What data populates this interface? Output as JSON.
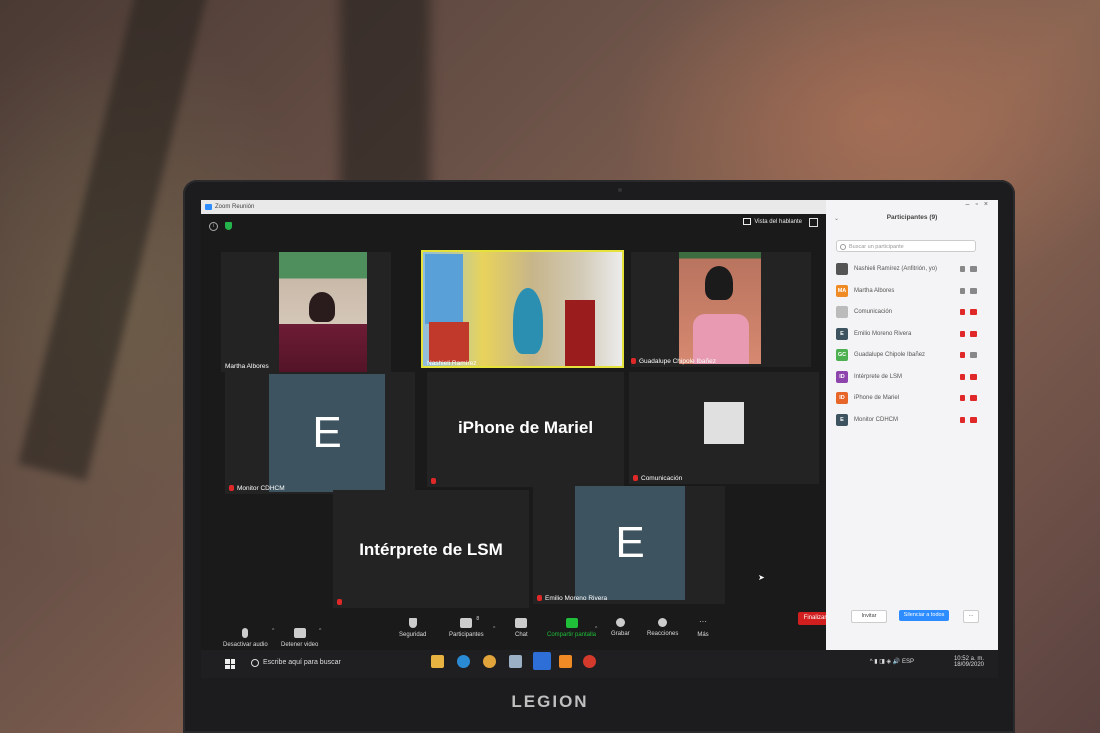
{
  "window": {
    "title": "Zoom Reunión",
    "speaker_view": "Vista del hablante"
  },
  "tiles": [
    {
      "name": "Martha Albores"
    },
    {
      "name": "Nashieli Ramírez"
    },
    {
      "name": "Guadalupe Chipole Ibañez"
    },
    {
      "name": "Monitor CDHCM",
      "initial": "E"
    },
    {
      "display": "iPhone de Mariel"
    },
    {
      "name": "Comunicación"
    },
    {
      "display": "Intérprete de LSM"
    },
    {
      "name": "Emilio Moreno Rivera",
      "initial": "E"
    }
  ],
  "toolbar": {
    "audio": "Desactivar audio",
    "video": "Detener video",
    "security": "Seguridad",
    "participants": "Participantes",
    "participants_count": "8",
    "chat": "Chat",
    "share": "Compartir pantalla",
    "record": "Grabar",
    "reactions": "Reacciones",
    "more": "Más",
    "end": "Finalizar"
  },
  "panel": {
    "title": "Participantes (9)",
    "search_placeholder": "Buscar un participante",
    "participants": [
      {
        "initials": "",
        "name": "Nashieli Ramírez (Anfitrión, yo)",
        "color": "#555555"
      },
      {
        "initials": "MA",
        "name": "Martha Albores",
        "color": "#f08a24"
      },
      {
        "initials": "",
        "name": "Comunicación",
        "color": "#bbbbbb"
      },
      {
        "initials": "E",
        "name": "Emilio Moreno Rivera",
        "color": "#3d5460"
      },
      {
        "initials": "GC",
        "name": "Guadalupe Chipole Ibañez",
        "color": "#4caf50"
      },
      {
        "initials": "ID",
        "name": "Intérprete de LSM",
        "color": "#8e44ad"
      },
      {
        "initials": "ID",
        "name": "iPhone de Mariel",
        "color": "#e8652a"
      },
      {
        "initials": "E",
        "name": "Monitor CDHCM",
        "color": "#3d5460"
      }
    ],
    "invite": "Invitar",
    "mute_all": "Silenciar a todos",
    "more": "..."
  },
  "taskbar": {
    "search": "Escribe aquí para buscar",
    "lang": "ESP",
    "time": "10:52 a. m.",
    "date": "18/09/2020"
  },
  "brand": "LEGION"
}
